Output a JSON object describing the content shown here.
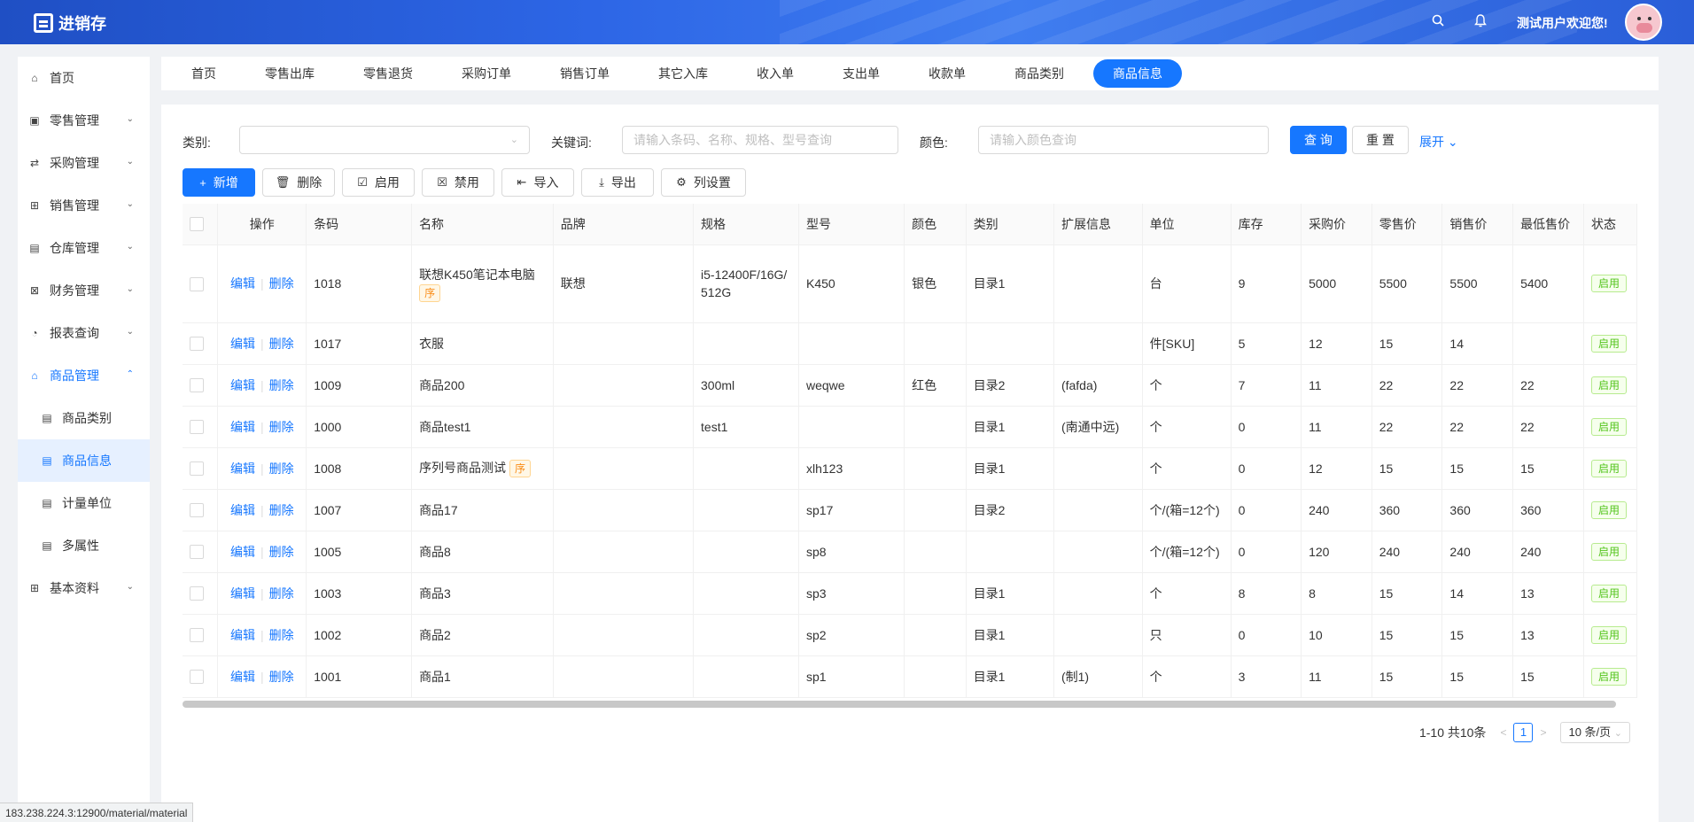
{
  "header": {
    "app_name": "进销存",
    "welcome": "测试用户欢迎您!"
  },
  "sidebar": {
    "items": [
      {
        "label": "首页",
        "icon": "home-icon"
      },
      {
        "label": "零售管理",
        "icon": "gift-icon"
      },
      {
        "label": "采购管理",
        "icon": "swap-icon"
      },
      {
        "label": "销售管理",
        "icon": "cart-icon"
      },
      {
        "label": "仓库管理",
        "icon": "warehouse-icon"
      },
      {
        "label": "财务管理",
        "icon": "finance-icon"
      },
      {
        "label": "报表查询",
        "icon": "pie-chart-icon"
      },
      {
        "label": "商品管理",
        "icon": "goods-icon"
      },
      {
        "label": "商品类别",
        "icon": "doc-icon"
      },
      {
        "label": "商品信息",
        "icon": "doc-icon"
      },
      {
        "label": "计量单位",
        "icon": "doc-icon"
      },
      {
        "label": "多属性",
        "icon": "doc-icon"
      },
      {
        "label": "基本资料",
        "icon": "grid-icon"
      }
    ]
  },
  "tabs": [
    "首页",
    "零售出库",
    "零售退货",
    "采购订单",
    "销售订单",
    "其它入库",
    "收入单",
    "支出单",
    "收款单",
    "商品类别",
    "商品信息"
  ],
  "filter": {
    "category_label": "类别:",
    "category_value": "",
    "keyword_label": "关键词:",
    "keyword_placeholder": "请输入条码、名称、规格、型号查询",
    "color_label": "颜色:",
    "color_placeholder": "请输入颜色查询",
    "search_button": "查 询",
    "reset_button": "重 置",
    "expand_link": "展开"
  },
  "toolbar": {
    "add": "新增",
    "delete": "删除",
    "enable": "启用",
    "disable": "禁用",
    "import": "导入",
    "export": "导出",
    "columns": "列设置"
  },
  "table": {
    "headers": [
      "操作",
      "条码",
      "名称",
      "品牌",
      "规格",
      "型号",
      "颜色",
      "类别",
      "扩展信息",
      "单位",
      "库存",
      "采购价",
      "零售价",
      "销售价",
      "最低售价",
      "状态"
    ],
    "edit_label": "编辑",
    "delete_label": "删除",
    "seq_tag": "序",
    "status_on": "启用",
    "rows": [
      {
        "code": "1018",
        "name": "联想K450笔记本电脑",
        "seq": true,
        "brand": "联想",
        "spec": "i5-12400F/16G/512G",
        "model": "K450",
        "color": "银色",
        "category": "目录1",
        "ext": "",
        "unit": "台",
        "stock": "9",
        "purchase": "5000",
        "retail": "5500",
        "sale": "5500",
        "min": "5400",
        "status": "启用"
      },
      {
        "code": "1017",
        "name": "衣服",
        "seq": false,
        "brand": "",
        "spec": "",
        "model": "",
        "color": "",
        "category": "",
        "ext": "",
        "unit": "件[SKU]",
        "stock": "5",
        "purchase": "12",
        "retail": "15",
        "sale": "14",
        "min": "",
        "status": "启用"
      },
      {
        "code": "1009",
        "name": "商品200",
        "seq": false,
        "brand": "",
        "spec": "300ml",
        "model": "weqwe",
        "color": "红色",
        "category": "目录2",
        "ext": "(fafda)",
        "unit": "个",
        "stock": "7",
        "purchase": "11",
        "retail": "22",
        "sale": "22",
        "min": "22",
        "status": "启用"
      },
      {
        "code": "1000",
        "name": "商品test1",
        "seq": false,
        "brand": "",
        "spec": "test1",
        "model": "",
        "color": "",
        "category": "目录1",
        "ext": "(南通中远)",
        "unit": "个",
        "stock": "0",
        "purchase": "11",
        "retail": "22",
        "sale": "22",
        "min": "22",
        "status": "启用"
      },
      {
        "code": "1008",
        "name": "序列号商品测试",
        "seq": true,
        "brand": "",
        "spec": "",
        "model": "xlh123",
        "color": "",
        "category": "目录1",
        "ext": "",
        "unit": "个",
        "stock": "0",
        "purchase": "12",
        "retail": "15",
        "sale": "15",
        "min": "15",
        "status": "启用"
      },
      {
        "code": "1007",
        "name": "商品17",
        "seq": false,
        "brand": "",
        "spec": "",
        "model": "sp17",
        "color": "",
        "category": "目录2",
        "ext": "",
        "unit": "个/(箱=12个)",
        "stock": "0",
        "purchase": "240",
        "retail": "360",
        "sale": "360",
        "min": "360",
        "status": "启用"
      },
      {
        "code": "1005",
        "name": "商品8",
        "seq": false,
        "brand": "",
        "spec": "",
        "model": "sp8",
        "color": "",
        "category": "",
        "ext": "",
        "unit": "个/(箱=12个)",
        "stock": "0",
        "purchase": "120",
        "retail": "240",
        "sale": "240",
        "min": "240",
        "status": "启用"
      },
      {
        "code": "1003",
        "name": "商品3",
        "seq": false,
        "brand": "",
        "spec": "",
        "model": "sp3",
        "color": "",
        "category": "目录1",
        "ext": "",
        "unit": "个",
        "stock": "8",
        "purchase": "8",
        "retail": "15",
        "sale": "14",
        "min": "13",
        "status": "启用"
      },
      {
        "code": "1002",
        "name": "商品2",
        "seq": false,
        "brand": "",
        "spec": "",
        "model": "sp2",
        "color": "",
        "category": "目录1",
        "ext": "",
        "unit": "只",
        "stock": "0",
        "purchase": "10",
        "retail": "15",
        "sale": "15",
        "min": "13",
        "status": "启用"
      },
      {
        "code": "1001",
        "name": "商品1",
        "seq": false,
        "brand": "",
        "spec": "",
        "model": "sp1",
        "color": "",
        "category": "目录1",
        "ext": "(制1)",
        "unit": "个",
        "stock": "3",
        "purchase": "11",
        "retail": "15",
        "sale": "15",
        "min": "15",
        "status": "启用"
      }
    ]
  },
  "pagination": {
    "summary": "1-10 共10条",
    "current": "1",
    "page_size": "10 条/页"
  },
  "status_url": "183.238.224.3:12900/material/material",
  "colors": {
    "primary": "#1677ff",
    "header": "#2d66e6"
  }
}
